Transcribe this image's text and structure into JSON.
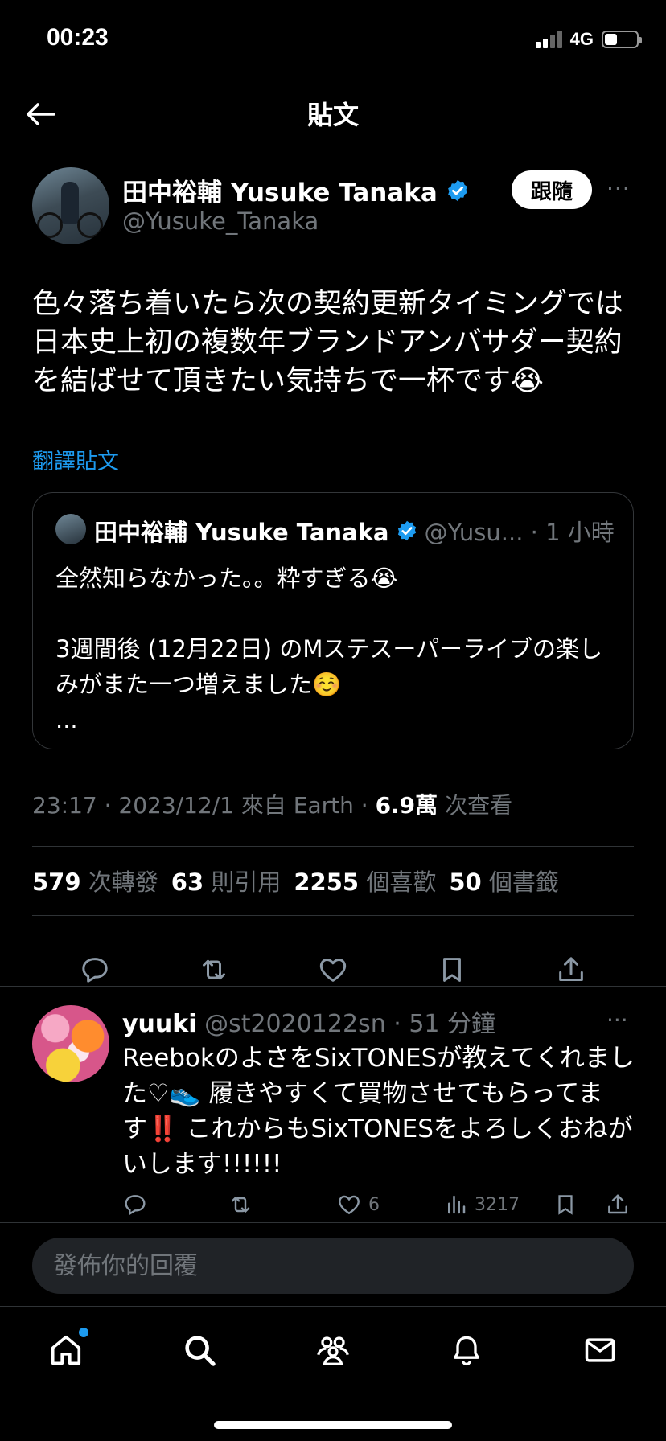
{
  "status_bar": {
    "time": "00:23",
    "network": "4G",
    "battery_level": 0.4
  },
  "nav": {
    "title": "貼文"
  },
  "post": {
    "author_name": "田中裕輔 Yusuke Tanaka",
    "author_handle": "@Yusuke_Tanaka",
    "follow_label": "跟隨",
    "more_label": "···",
    "body": "色々落ち着いたら次の契約更新タイミングでは日本史上初の複数年ブランドアンバサダー契約を結ばせて頂きたい気持ちで一杯です😭",
    "translate_label": "翻譯貼文",
    "timestamp": "23:17 · 2023/12/1 來自 Earth ·",
    "views_count": "6.9萬",
    "views_label": "次查看",
    "stats": {
      "reposts_count": "579",
      "reposts_label": "次轉發",
      "quotes_count": "63",
      "quotes_label": "則引用",
      "likes_count": "2255",
      "likes_label": "個喜歡",
      "bookmarks_count": "50",
      "bookmarks_label": "個書籤"
    }
  },
  "quote": {
    "author_name": "田中裕輔 Yusuke Tanaka",
    "meta": "@Yusu... · 1 小時",
    "body": "全然知らなかった。。粋すぎる😭\n\n3週間後 (12月22日) のMステスーパーライブの楽しみがまた一つ増えました☺️\n..."
  },
  "reply": {
    "author_name": "yuuki",
    "meta": "@st2020122sn · 51 分鐘",
    "more_label": "···",
    "body": "ReebokのよさをSixTONESが教えてくれました♡👟 履きやすくて買物させてもらってます‼️ これからもSixTONESをよろしくおねがいします!!!!!!",
    "likes": "6",
    "views": "3217"
  },
  "composer": {
    "placeholder": "發佈你的回覆"
  },
  "colors": {
    "accent": "#1d9bf0",
    "background": "#000000",
    "secondary_text": "#71767b"
  },
  "icons": [
    "back-arrow-icon",
    "verified-badge-icon",
    "reply-icon",
    "repost-icon",
    "like-icon",
    "bookmark-icon",
    "share-icon",
    "views-icon",
    "home-icon",
    "search-icon",
    "communities-icon",
    "notifications-icon",
    "messages-icon"
  ]
}
